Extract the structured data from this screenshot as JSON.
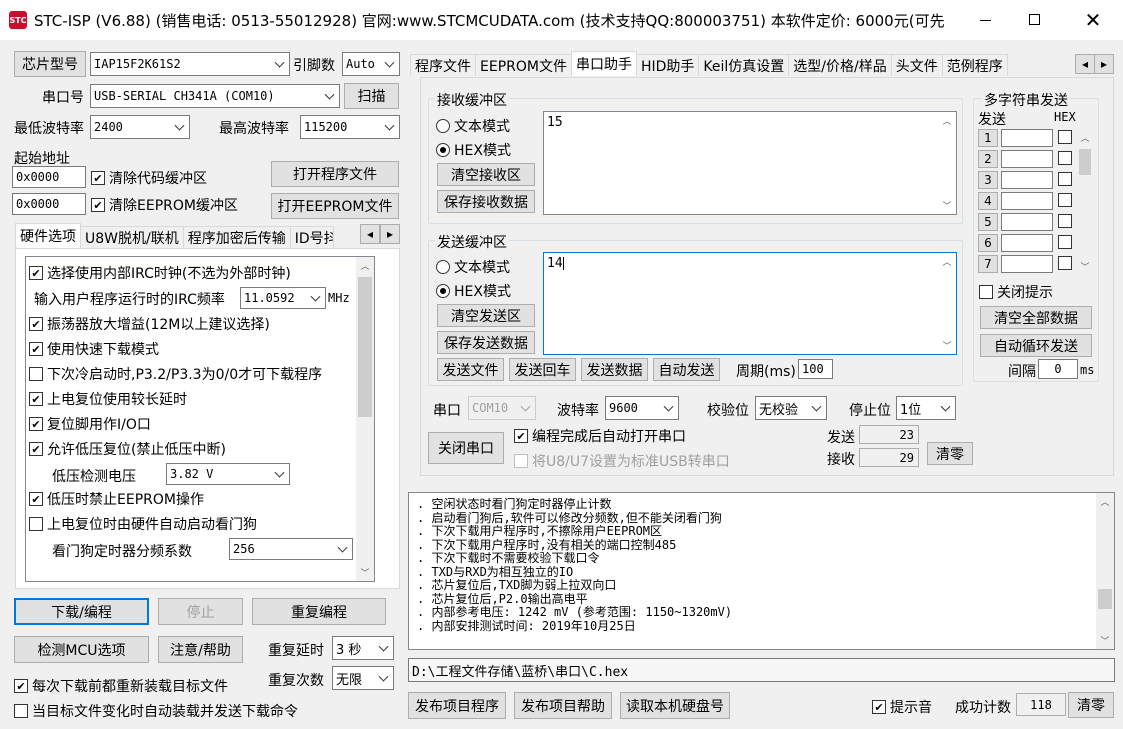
{
  "window": {
    "title": "STC-ISP (V6.88) (销售电话: 0513-55012928) 官网:www.STCMCUDATA.com  (技术支持QQ:800003751) 本软件定价: 6000元(可先…",
    "colors": {
      "accent": "#0078d7",
      "bg": "#f0f0f0",
      "btn": "#e1e1e1"
    }
  },
  "left": {
    "chip_label": "芯片型号",
    "chip_value": "IAP15F2K61S2",
    "pins_label": "引脚数",
    "pins_value": "Auto",
    "port_label": "串口号",
    "port_value": "USB-SERIAL CH341A (COM10)",
    "scan_button": "扫描",
    "min_baud_label": "最低波特率",
    "min_baud_value": "2400",
    "max_baud_label": "最高波特率",
    "max_baud_value": "115200",
    "start_addr_label": "起始地址",
    "addr1": "0x0000",
    "clear_code_label": "清除代码缓冲区",
    "open_program_button": "打开程序文件",
    "addr2": "0x0000",
    "clear_eeprom_label": "清除EEPROM缓冲区",
    "open_eeprom_button": "打开EEPROM文件",
    "tabs": [
      "硬件选项",
      "U8W脱机/联机",
      "程序加密后传输",
      "ID号抖"
    ],
    "hw": {
      "opt1": "选择使用内部IRC时钟(不选为外部时钟)",
      "irc_label": "输入用户程序运行时的IRC频率",
      "irc_value": "11.0592",
      "irc_unit": "MHz",
      "opt2": "振荡器放大增益(12M以上建议选择)",
      "opt3": "使用快速下载模式",
      "opt4": "下次冷启动时,P3.2/P3.3为0/0才可下载程序",
      "opt5": "上电复位使用较长延时",
      "opt6": "复位脚用作I/O口",
      "opt7": "允许低压复位(禁止低压中断)",
      "lv_label": "低压检测电压",
      "lv_value": "3.82 V",
      "opt8": "低压时禁止EEPROM操作",
      "opt9": "上电复位时由硬件自动启动看门狗",
      "wdt_label": "看门狗定时器分频系数",
      "wdt_value": "256"
    },
    "download_button": "下载/编程",
    "stop_button": "停止",
    "reprogram_button": "重复编程",
    "check_mcu_button": "检测MCU选项",
    "help_button": "注意/帮助",
    "repeat_delay_label": "重复延时",
    "repeat_delay_value": "3 秒",
    "repeat_count_label": "重复次数",
    "repeat_count_value": "无限",
    "reload_label": "每次下载前都重新装载目标文件",
    "auto_send_label": "当目标文件变化时自动装载并发送下载命令"
  },
  "right": {
    "tabs": [
      "程序文件",
      "EEPROM文件",
      "串口助手",
      "HID助手",
      "Keil仿真设置",
      "选型/价格/样品",
      "头文件",
      "范例程序"
    ],
    "recv": {
      "title": "接收缓冲区",
      "text_mode": "文本模式",
      "hex_mode": "HEX模式",
      "clear_button": "清空接收区",
      "save_button": "保存接收数据",
      "content": "15"
    },
    "send": {
      "title": "发送缓冲区",
      "text_mode": "文本模式",
      "hex_mode": "HEX模式",
      "clear_button": "清空发送区",
      "save_button": "保存发送数据",
      "content": "14"
    },
    "send_file_button": "发送文件",
    "send_return_button": "发送回车",
    "send_data_button": "发送数据",
    "auto_send_button": "自动发送",
    "period_label": "周期(ms)",
    "period_value": "100",
    "multi": {
      "title": "多字符串发送",
      "send_col": "发送",
      "hex_col": "HEX",
      "rows": [
        "1",
        "2",
        "3",
        "4",
        "5",
        "6",
        "7"
      ],
      "close_tip": "关闭提示",
      "clear_all_button": "清空全部数据",
      "auto_loop_button": "自动循环发送",
      "interval_label": "间隔",
      "interval_value": "0",
      "interval_unit": "ms"
    },
    "port_label": "串口",
    "port_value": "COM10",
    "baud_label": "波特率",
    "baud_value": "9600",
    "parity_label": "校验位",
    "parity_value": "无校验",
    "stop_label": "停止位",
    "stop_value": "1位",
    "close_port_button": "关闭串口",
    "auto_open_label": "编程完成后自动打开串口",
    "usb_label": "将U8/U7设置为标准USB转串口",
    "send_count_label": "发送",
    "send_count": "23",
    "recv_count_label": "接收",
    "recv_count": "29",
    "zero_button": "清零"
  },
  "log": [
    ". 空闲状态时看门狗定时器停止计数",
    ". 启动看门狗后,软件可以修改分频数,但不能关闭看门狗",
    ". 下次下载用户程序时,不擦除用户EEPROM区",
    ". 下次下载用户程序时,没有相关的端口控制485",
    ". 下次下载时不需要校验下载口令",
    ". TXD与RXD为相互独立的IO",
    ". 芯片复位后,TXD脚为弱上拉双向口",
    ". 芯片复位后,P2.0输出高电平",
    ". 内部参考电压: 1242 mV (参考范围: 1150~1320mV)",
    ". 内部安排测试时间: 2019年10月25日"
  ],
  "path": "D:\\工程文件存储\\蓝桥\\串口\\C.hex",
  "bottom": {
    "publish_button": "发布项目程序",
    "publish_help_button": "发布项目帮助",
    "read_disk_button": "读取本机硬盘号",
    "sound_label": "提示音",
    "success_label": "成功计数",
    "success_value": "118",
    "clear_button": "清零"
  }
}
